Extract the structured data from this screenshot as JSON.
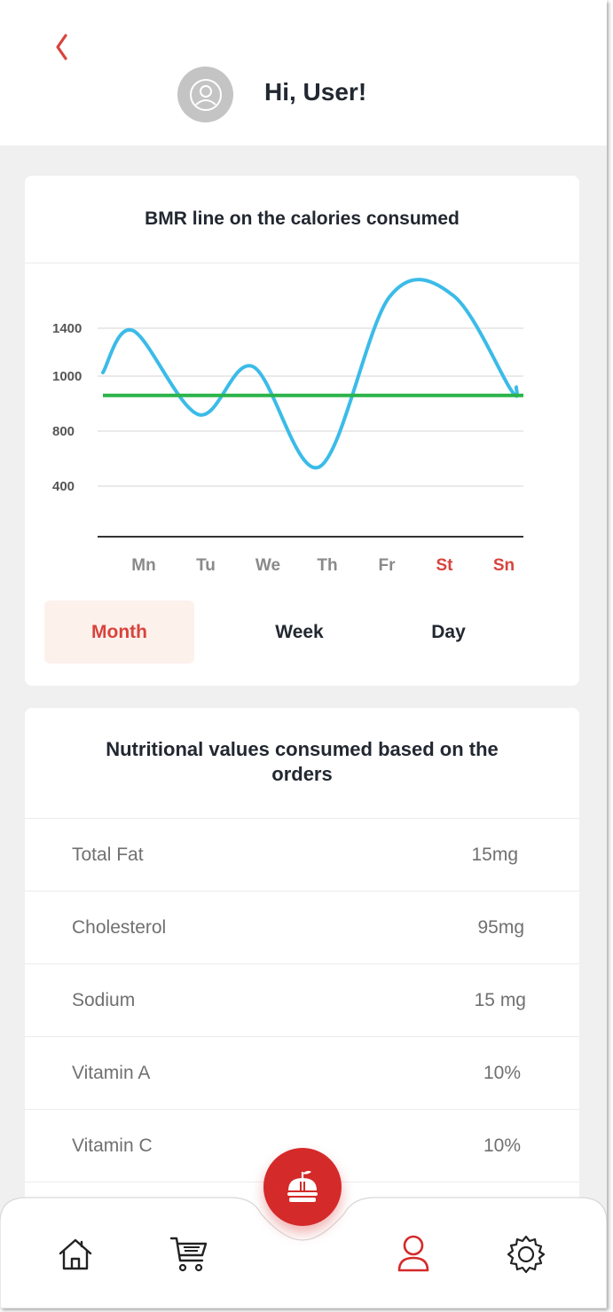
{
  "header": {
    "greeting": "Hi, User!"
  },
  "bmr_card": {
    "title": "BMR line on the calories consumed",
    "tabs": [
      {
        "label": "Month",
        "active": true
      },
      {
        "label": "Week",
        "active": false
      },
      {
        "label": "Day",
        "active": false
      }
    ]
  },
  "chart_data": {
    "type": "line",
    "title": "BMR line on the calories consumed",
    "categories": [
      "Mn",
      "Tu",
      "We",
      "Th",
      "Fr",
      "St",
      "Sn"
    ],
    "weekend_categories": [
      "St",
      "Sn"
    ],
    "y_ticks": [
      400,
      800,
      1000,
      1400
    ],
    "series": [
      {
        "values": [
          1380,
          860,
          1080,
          540,
          1630,
          1640,
          950
        ],
        "color": "#3bbbe8"
      },
      {
        "values": [
          930,
          930,
          930,
          930,
          930,
          930,
          930
        ],
        "color": "#2bb34a"
      }
    ],
    "grid": true,
    "colors": {
      "tick_label": "#8a8a8a",
      "weekend_label": "#d9433d",
      "axis": "#333333"
    }
  },
  "nutrition": {
    "title": "Nutritional values consumed based on the orders",
    "rows": [
      {
        "name": "Total Fat",
        "value": "15mg"
      },
      {
        "name": "Cholesterol",
        "value": "95mg"
      },
      {
        "name": "Sodium",
        "value": "15 mg"
      },
      {
        "name": "Vitamin A",
        "value": "10%"
      },
      {
        "name": "Vitamin C",
        "value": "10%"
      }
    ]
  },
  "nav": {
    "items": [
      "home-icon",
      "cart-icon",
      "food-icon",
      "profile-icon",
      "settings-icon"
    ],
    "active": "profile-icon",
    "accent": "#d42a2a"
  }
}
